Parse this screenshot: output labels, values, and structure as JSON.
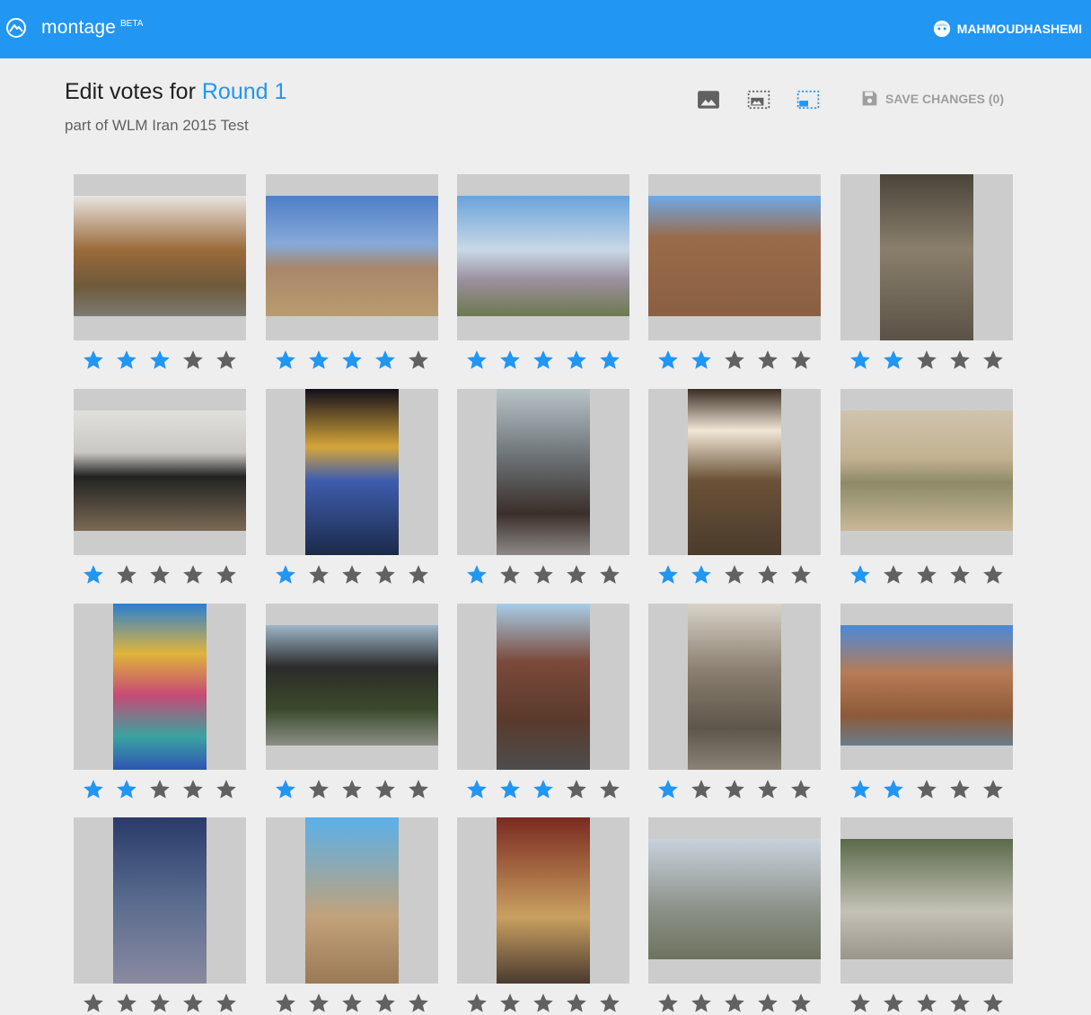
{
  "header": {
    "app_name": "montage",
    "beta_label": "BETA",
    "username": "MAHMOUDHASHEMI",
    "accent_color": "#2196f3"
  },
  "page": {
    "title_prefix": "Edit votes for ",
    "round_name": "Round 1",
    "subtitle": "part of WLM Iran 2015 Test"
  },
  "toolbar": {
    "view_modes": [
      {
        "icon": "image-icon",
        "active": false
      },
      {
        "icon": "image-frame-icon",
        "active": false
      },
      {
        "icon": "picture-in-picture-icon",
        "active": true
      }
    ],
    "save_label": "SAVE CHANGES (0)",
    "save_icon": "floppy-disk-icon"
  },
  "rating": {
    "max": 5,
    "active_color": "#2196f3",
    "inactive_color": "#616161"
  },
  "entries": [
    {
      "rating": 3,
      "orientation": "landscape",
      "bg": "linear-gradient(180deg,#e8e4e0 0%,#9b6a3a 45%,#6e5a3c 75%,#7d7a72 100%)"
    },
    {
      "rating": 4,
      "orientation": "landscape",
      "bg": "linear-gradient(180deg,#4f7fc8 0%,#86a9d8 40%,#a8876a 60%,#b99b6f 100%)"
    },
    {
      "rating": 5,
      "orientation": "landscape",
      "bg": "linear-gradient(180deg,#6aa3dc 0%,#c9d8e6 45%,#9b8f9e 70%,#6d7a4e 100%)"
    },
    {
      "rating": 2,
      "orientation": "landscape",
      "bg": "linear-gradient(180deg,#6ea9e6 0%,#9a6b4a 35%,#8a5f42 100%)"
    },
    {
      "rating": 2,
      "orientation": "portrait",
      "bg": "linear-gradient(180deg,#4a4439 0%,#8a7f6c 45%,#5b5246 100%)"
    },
    {
      "rating": 1,
      "orientation": "landscape",
      "bg": "linear-gradient(180deg,#e0e0de 0%,#c9c7c2 35%,#222 55%,#7a6a55 100%)"
    },
    {
      "rating": 1,
      "orientation": "portrait",
      "bg": "linear-gradient(180deg,#120f1a 0%,#d5a53a 35%,#3f5dae 55%,#1b2a4a 100%)"
    },
    {
      "rating": 1,
      "orientation": "portrait",
      "bg": "linear-gradient(180deg,#b9c4c8 0%,#6d7478 40%,#3b2f2b 75%,#8e8a87 100%)"
    },
    {
      "rating": 2,
      "orientation": "portrait",
      "bg": "linear-gradient(180deg,#3a2c22 0%,#f0e6d5 25%,#6b5238 55%,#4a3b2c 100%)"
    },
    {
      "rating": 1,
      "orientation": "landscape",
      "bg": "linear-gradient(180deg,#cfc3ad 0%,#c2b190 40%,#8d8a68 60%,#c9b898 100%)"
    },
    {
      "rating": 2,
      "orientation": "portrait",
      "bg": "linear-gradient(180deg,#2a7fd0 0%,#e0b43a 30%,#c74a75 55%,#3aa3a0 80%,#2e55b3 100%)"
    },
    {
      "rating": 1,
      "orientation": "landscape",
      "bg": "linear-gradient(180deg,#9db7c9 0%,#2b2b2b 35%,#3b4a2a 70%,#8c8f88 100%)"
    },
    {
      "rating": 3,
      "orientation": "portrait",
      "bg": "linear-gradient(180deg,#a8cde8 0%,#7b4a3a 35%,#5a3a2c 70%,#4d4d4d 100%)"
    },
    {
      "rating": 1,
      "orientation": "portrait",
      "bg": "linear-gradient(180deg,#d9d3c8 0%,#8a7f70 40%,#5e564a 75%,#8a8276 100%)"
    },
    {
      "rating": 2,
      "orientation": "landscape",
      "bg": "linear-gradient(180deg,#4a8ad8 0%,#b77b55 40%,#8c5a3a 75%,#6a7c8a 100%)"
    },
    {
      "rating": 0,
      "orientation": "portrait",
      "bg": "linear-gradient(180deg,#2a3a6a 0%,#596b8e 50%,#8a8aa0 100%)"
    },
    {
      "rating": 0,
      "orientation": "portrait",
      "bg": "linear-gradient(180deg,#5ab0e8 0%,#c2a27a 60%,#9a7a56 100%)"
    },
    {
      "rating": 0,
      "orientation": "portrait",
      "bg": "linear-gradient(180deg,#7a2a20 0%,#c9a060 60%,#4a3a30 100%)"
    },
    {
      "rating": 0,
      "orientation": "landscape",
      "bg": "linear-gradient(180deg,#c8d2dc 0%,#8a8f86 60%,#6e735f 100%)"
    },
    {
      "rating": 0,
      "orientation": "landscape",
      "bg": "linear-gradient(180deg,#5a6a4a 0%,#c4c1b6 60%,#9b958a 100%)"
    }
  ]
}
